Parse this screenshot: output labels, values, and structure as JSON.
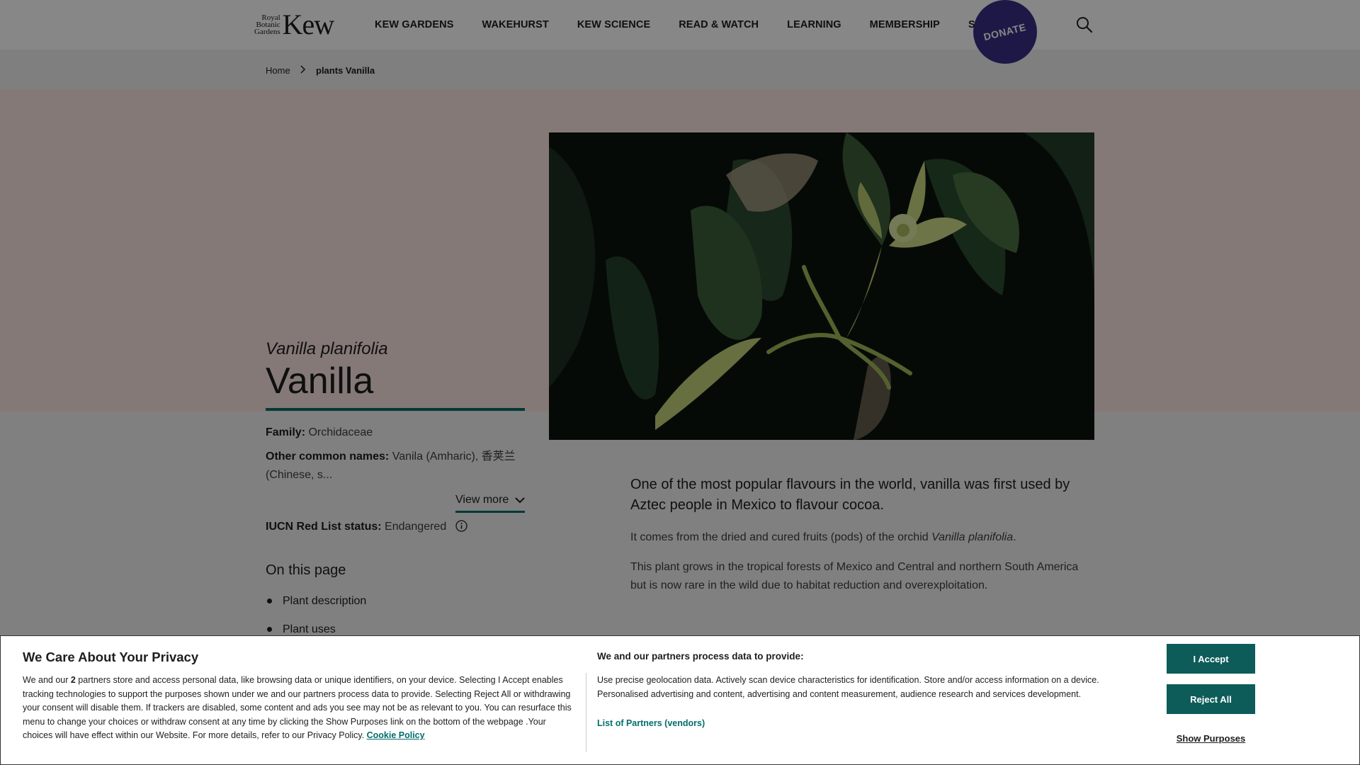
{
  "logo": {
    "small_line1": "Royal",
    "small_line2": "Botanic",
    "small_line3": "Gardens",
    "big": "Kew"
  },
  "nav": {
    "items": [
      "KEW GARDENS",
      "WAKEHURST",
      "KEW SCIENCE",
      "READ & WATCH",
      "LEARNING",
      "MEMBERSHIP",
      "SHOP"
    ],
    "donate_label": "DONATE",
    "search_icon": "search-icon"
  },
  "breadcrumb": {
    "home": "Home",
    "current": "plants Vanilla"
  },
  "hero": {
    "latin_name": "Vanilla planifolia",
    "title": "Vanilla",
    "image": "vanilla-orchid-photo"
  },
  "facts": {
    "family_label": "Family:",
    "family_value": "Orchidaceae",
    "common_label": "Other common names:",
    "common_value_line1": "Vanila (Amharic), 香荚兰",
    "common_value_line2": "(Chinese, s...",
    "view_more": "View more",
    "iucn_label": "IUCN Red List status:",
    "iucn_value": "Endangered"
  },
  "on_this_page": {
    "heading": "On this page",
    "items": [
      "Plant description",
      "Plant uses"
    ]
  },
  "intro": {
    "lead": "One of the most popular flavours in the world, vanilla was first used by Aztec people in Mexico to flavour cocoa.",
    "p1_before": "It comes from the dried and cured fruits (pods) of the orchid ",
    "p1_italic": "Vanilla planifolia",
    "p1_after": ".",
    "p2": "This plant grows in the tropical forests of Mexico and Central and northern South America but is now rare in the wild due to habitat reduction and overexploitation."
  },
  "cookie": {
    "title": "We Care About Your Privacy",
    "text_1": "We and our ",
    "text_count": "2",
    "text_2": " partners store and access personal data, like browsing data or unique identifiers, on your device. Selecting I Accept enables tracking technologies to support the purposes shown under we and our partners process data to provide. Selecting Reject All or withdrawing your consent will disable them. If trackers are disabled, some content and ads you see may not be as relevant to you. You can resurface this menu to change your choices or withdraw consent at any time by clicking the Show Purposes link on the bottom of the webpage .Your choices will have effect within our Website. For more details, refer to our Privacy Policy. ",
    "policy_link": "Cookie Policy",
    "sub_title": "We and our partners process data to provide:",
    "purposes": "Use precise geolocation data. Actively scan device characteristics for identification. Store and/or access information on a device. Personalised advertising and content, advertising and content measurement, audience research and services development.",
    "partners_link": "List of Partners (vendors)",
    "accept": "I Accept",
    "reject": "Reject All",
    "show_purposes": "Show Purposes"
  },
  "colors": {
    "accent_teal": "#006e6d",
    "donate_purple": "#3a2f86",
    "hero_pink": "#fbe5e1",
    "button_teal": "#0d5c5a"
  }
}
